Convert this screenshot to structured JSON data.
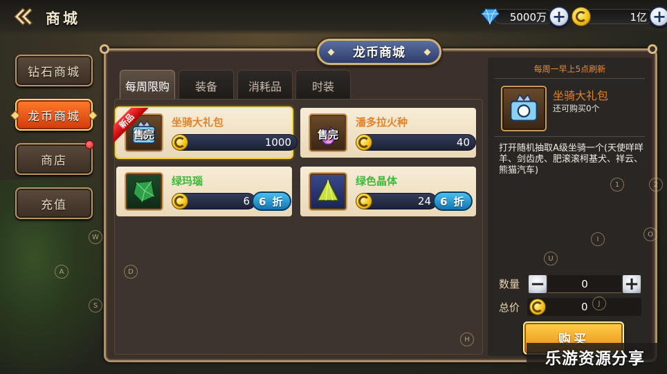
{
  "header": {
    "title": "商城",
    "diamond_amount": "5000万",
    "coin_amount": "1亿"
  },
  "sidebar": {
    "items": [
      {
        "label": "钻石商城",
        "active": false
      },
      {
        "label": "龙币商城",
        "active": true
      },
      {
        "label": "商店",
        "active": false,
        "badge": true
      },
      {
        "label": "充值",
        "active": false
      }
    ]
  },
  "panel": {
    "title": "龙币商城"
  },
  "tabs": [
    {
      "label": "每周限购",
      "active": true
    },
    {
      "label": "装备",
      "active": false
    },
    {
      "label": "消耗品",
      "active": false
    },
    {
      "label": "时装",
      "active": false
    }
  ],
  "items": [
    {
      "name": "坐骑大礼包",
      "price": "1000",
      "sold_out": "售完",
      "new_tag": "新品",
      "selected": true,
      "icon": "mount-chest-icon"
    },
    {
      "name": "潘多拉火种",
      "price": "40",
      "sold_out": "售完",
      "icon": "pandora-flame-icon"
    },
    {
      "name": "绿玛瑙",
      "price": "6",
      "discount": "6 折",
      "icon": "green-agate-icon"
    },
    {
      "name": "绿色晶体",
      "price": "24",
      "discount": "6 折",
      "icon": "green-crystal-icon"
    }
  ],
  "detail": {
    "refresh_note": "每周一早上5点刷新",
    "name": "坐骑大礼包",
    "remaining": "还可购买0个",
    "description": "打开随机抽取A级坐骑一个(天使咩咩羊、剑齿虎、肥滚滚柯基犬、祥云、熊猫汽车)",
    "qty_label": "数量",
    "qty_value": "0",
    "total_label": "总价",
    "total_value": "0",
    "buy_label": "购买"
  },
  "key_hints": [
    "W",
    "A",
    "S",
    "D",
    "1",
    "2",
    "I",
    "O",
    "U",
    "J",
    "H"
  ],
  "watermark": "乐游资源分享",
  "colors": {
    "accent_orange": "#e0832a",
    "active_tab": "#d23a0c",
    "discount_blue": "#1574b0",
    "item_green": "#3eb83a"
  }
}
